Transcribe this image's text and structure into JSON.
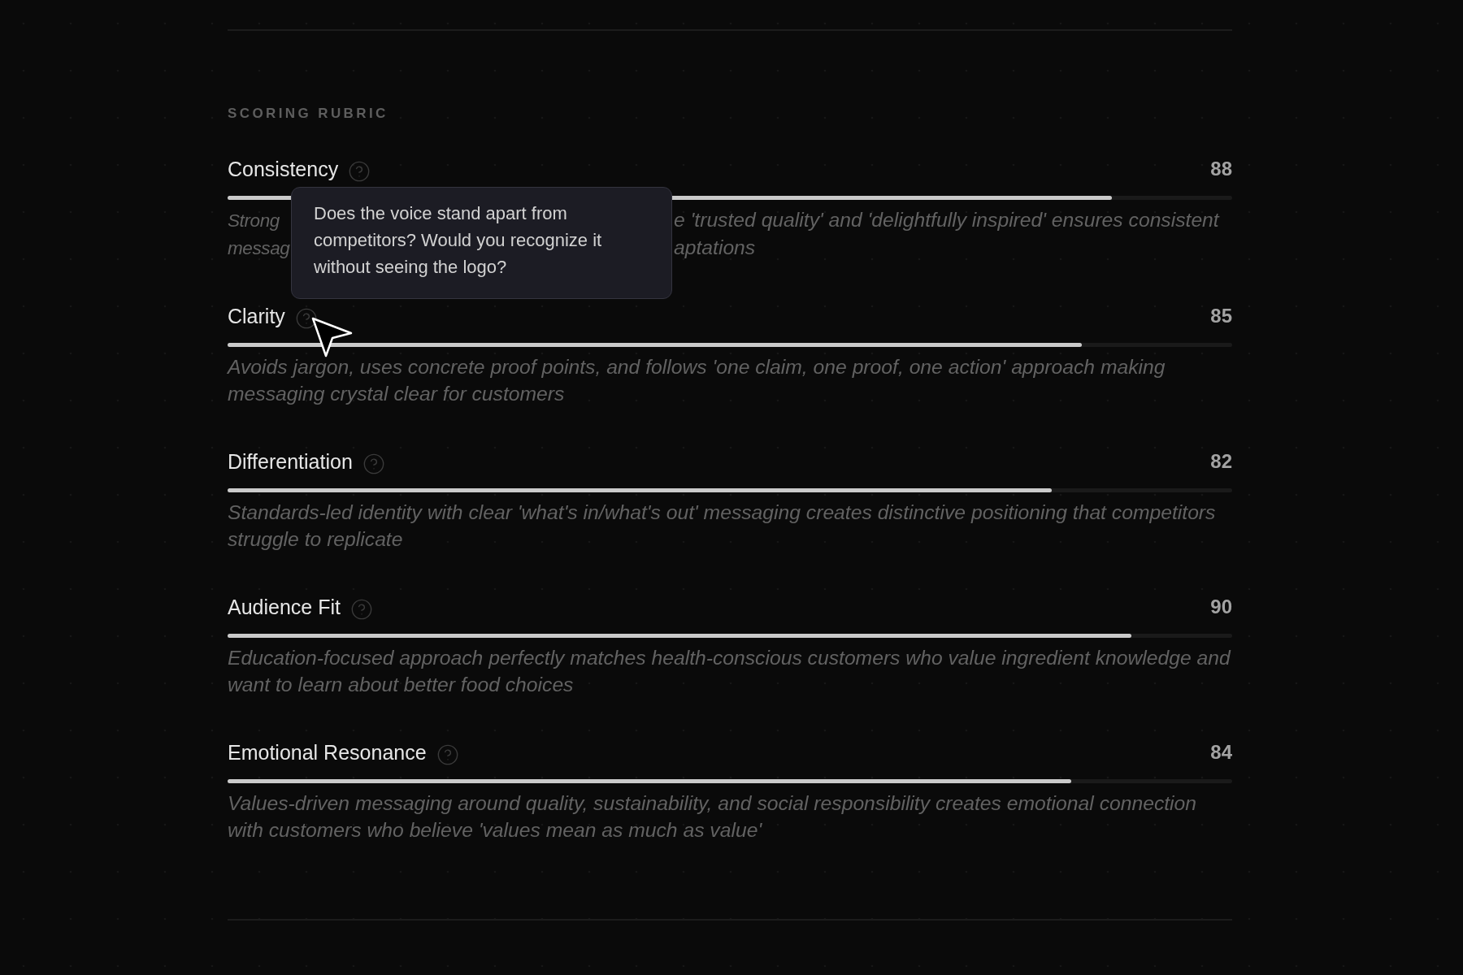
{
  "section": {
    "title": "SCORING RUBRIC"
  },
  "rubric": [
    {
      "name": "Consistency",
      "score": "88",
      "level": 0.88,
      "visible_description_lines": [
        [
          "Strong",
          "e 'trusted quality' and 'delightfully inspired' ensures consistent"
        ],
        [
          "messag",
          "aptations"
        ]
      ]
    },
    {
      "name": "Clarity",
      "score": "85",
      "level": 0.85,
      "description": "Avoids jargon, uses concrete proof points, and follows 'one claim, one proof, one action' approach making messaging crystal clear for customers",
      "tooltip": "Does the voice stand apart from competitors? Would you recognize it without seeing the logo?"
    },
    {
      "name": "Differentiation",
      "score": "82",
      "level": 0.82,
      "description": "Standards-led identity with clear 'what's in/what's out' messaging creates distinctive positioning that competitors struggle to replicate"
    },
    {
      "name": "Audience Fit",
      "score": "90",
      "level": 0.9,
      "description": "Education-focused approach perfectly matches health-conscious customers who value ingredient knowledge and want to learn about better food choices"
    },
    {
      "name": "Emotional Resonance",
      "score": "84",
      "level": 0.84,
      "description": "Values-driven messaging around quality, sustainability, and social responsibility creates emotional connection with customers who believe 'values mean as much as value'"
    }
  ]
}
